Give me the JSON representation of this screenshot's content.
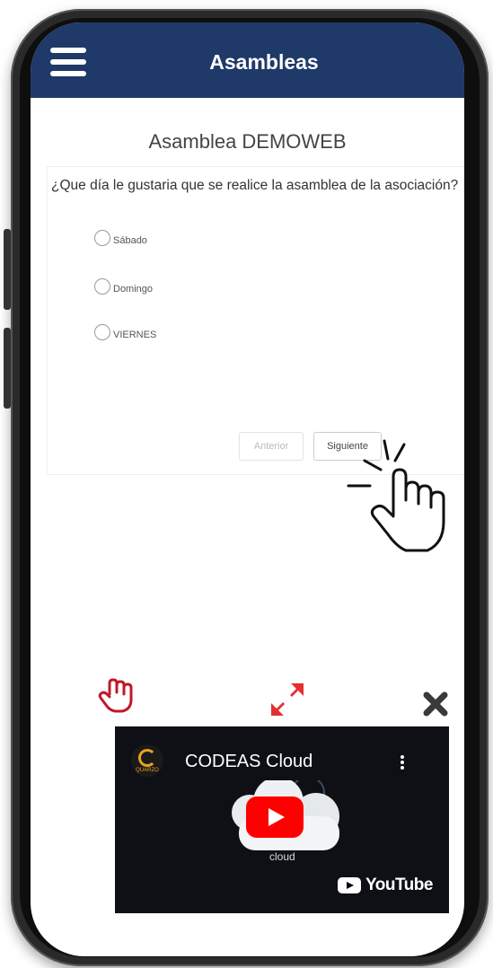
{
  "header": {
    "title": "Asambleas",
    "menu_icon": "hamburger-menu-icon"
  },
  "assembly": {
    "title": "Asamblea DEMOWEB"
  },
  "survey": {
    "question": "¿Que día le gustaria que se realice la asamblea de la asociación?",
    "options": [
      {
        "label": "Sábado",
        "selected": false
      },
      {
        "label": "Domingo",
        "selected": false
      },
      {
        "label": "VIERNES",
        "selected": false
      }
    ],
    "prev_label": "Anterior",
    "next_label": "Siguiente"
  },
  "video": {
    "title": "CODEAS Cloud",
    "channel_logo_text": "QUARZO",
    "art_text": "cloud",
    "platform": "YouTube"
  },
  "colors": {
    "header": "#1f3a68",
    "drag_icon": "#c0182a",
    "expand_icon": "#e53030",
    "play": "#ff0000"
  }
}
